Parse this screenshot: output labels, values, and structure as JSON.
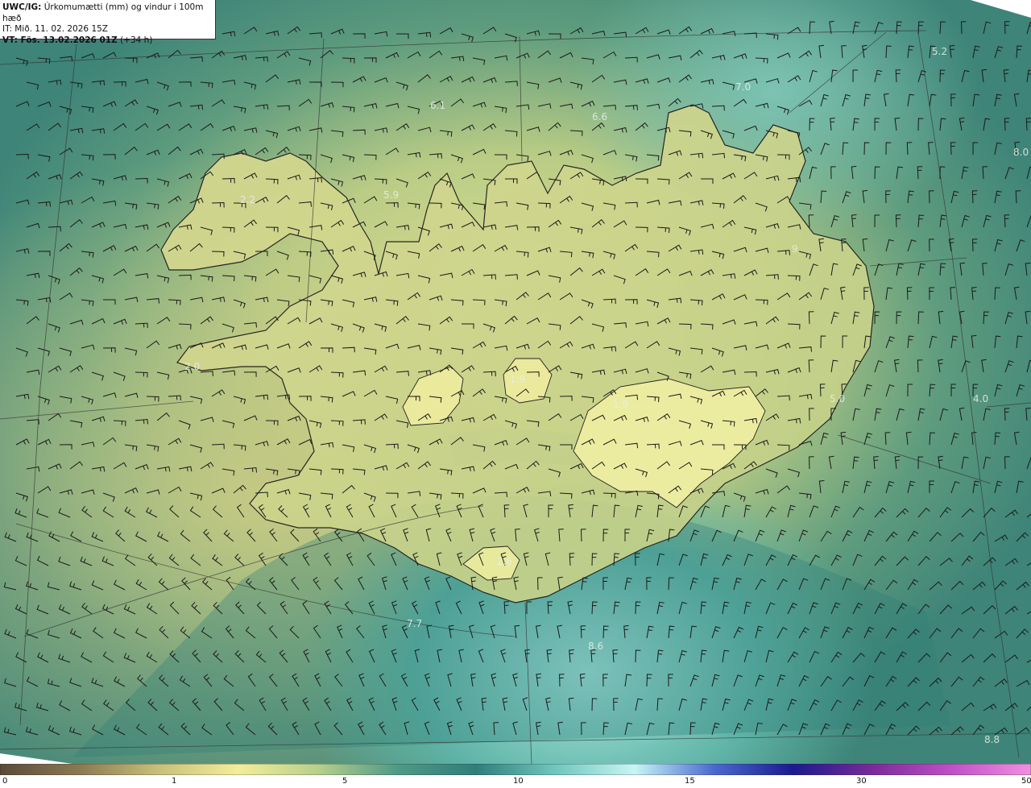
{
  "header": {
    "product": "UWC/IG:",
    "title": "Úrkomumætti (mm) og vindur i 100m hæð",
    "issue_time": "IT: Mið. 11. 02. 2026 15Z",
    "valid_prefix": "VT: Fös. 13.02.2026 01Z",
    "valid_offset": "(+34 h)"
  },
  "colorbar": {
    "ticks": [
      {
        "label": "0",
        "value": 0
      },
      {
        "label": "1",
        "value": 1
      },
      {
        "label": "5",
        "value": 5
      },
      {
        "label": "10",
        "value": 10
      },
      {
        "label": "15",
        "value": 15
      },
      {
        "label": "30",
        "value": 30
      },
      {
        "label": "50",
        "value": 50
      }
    ],
    "colors": [
      "#5b4a3a",
      "#8a7a52",
      "#c8c07a",
      "#f2ee9a",
      "#b8d08c",
      "#4f9a86",
      "#2f7e7a",
      "#6fc7bd",
      "#c8f5f5",
      "#4a6ad0",
      "#1a1a8e",
      "#7a2a9a",
      "#c050c8",
      "#f090e0"
    ]
  },
  "labels": [
    {
      "text": "6.1"
    },
    {
      "text": "6.6"
    },
    {
      "text": "7.0"
    },
    {
      "text": "5.2"
    },
    {
      "text": "8.0"
    },
    {
      "text": "5.9"
    },
    {
      "text": "2.2"
    },
    {
      "text": "9"
    },
    {
      "text": "2.0"
    },
    {
      "text": "1.9"
    },
    {
      "text": "1.9"
    },
    {
      "text": "5.0"
    },
    {
      "text": "4.0"
    },
    {
      "text": "2.6"
    },
    {
      "text": "7.7"
    },
    {
      "text": "8.6"
    },
    {
      "text": "8.8"
    }
  ]
}
